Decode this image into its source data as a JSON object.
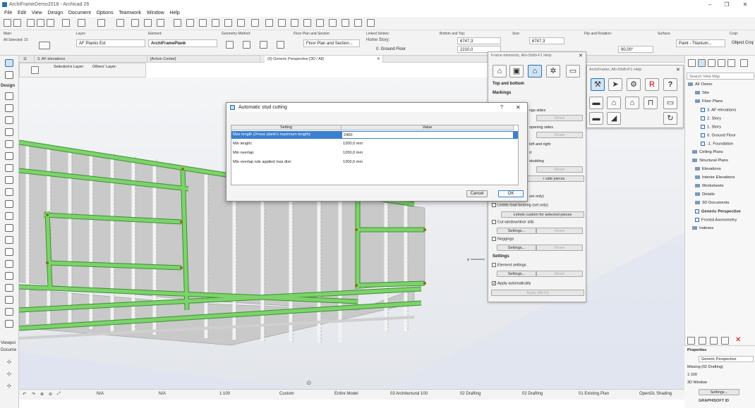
{
  "app": {
    "title": "ArchiFrameDemo2018 - Archicad 26"
  },
  "menu": [
    "File",
    "Edit",
    "View",
    "Design",
    "Document",
    "Options",
    "Teamwork",
    "Window",
    "Help"
  ],
  "infobox": {
    "main_label": "Main:",
    "all_selected": "All Selected: 15",
    "layer_label": "Layer:",
    "layer_value": "AF Planks Ext",
    "element_label": "Element:",
    "element_value": "ArchiFramePlank",
    "geometry_label": "Geometry Method:",
    "floorplan_label": "Floor Plan and Section:",
    "floorplan_value": "Floor Plan and Section...",
    "linked_label": "Linked Stories:",
    "home_story_label": "Home Story:",
    "home_story_value": "0. Ground Floor",
    "bottom_top_label": "Bottom and Top:",
    "top_value": "6747,3",
    "bottom_value": "2210,0",
    "size_label": "Size:",
    "size_value": "6747,3",
    "flip_label": "Flip and Rotation:",
    "rotation_value": "90,00°",
    "surface_label": "Surface:",
    "surface_value": "Paint - Titanium...",
    "crop_label": "Crop:",
    "crop_value": "Object Crop"
  },
  "toolbox": {
    "design": "Design",
    "viewpoint": "Viewpoi",
    "document": "Docume"
  },
  "tabs": [
    "3. AF elevations",
    "[Action Center]",
    "(0) Generic Perspective [3D / All]"
  ],
  "layerbar": {
    "selection_layer": "Selection's Layer:",
    "others_layer": "Others' Layer:"
  },
  "dialog": {
    "title": "Automatic stud cutting",
    "help": "?",
    "col_setting": "Setting",
    "col_value": "Value",
    "rows": [
      {
        "setting": "Max length (0=use plank's maximum length):",
        "value": "2400"
      },
      {
        "setting": "Min length:",
        "value": "1200,0 mm"
      },
      {
        "setting": "Min overlap:",
        "value": "1200,0 mm"
      },
      {
        "setting": "Min overlap rule applied max dist:",
        "value": "1200,0 mm"
      }
    ],
    "cancel": "Cancel",
    "ok": "OK"
  },
  "frame_palette": {
    "title": "Frame elements, Alt+Shift+F1 Help",
    "top_bottom": "Top and bottom",
    "markings": "Markings",
    "partial_1": "ngs sides",
    "reset": "Reset",
    "partial_2": "opening sides",
    "partial_3": "left and right",
    "partial_4": "rt",
    "partial_5": "studding",
    "side_pieces": "r side pieces",
    "partial_6": "set only)",
    "lintels_load": "Lintels load bearing (set only)",
    "lintels_custom": "Lintels custom for selected pieces",
    "cut_window": "Cut window/door sills",
    "settings_btn": "Settings...",
    "noggings": "Noggings",
    "settings_head": "Settings",
    "element_settings": "Element settings",
    "apply_auto": "Apply automatically",
    "apply_btn": "Apply (Alt+0)"
  },
  "frame_palette2": {
    "title": "ArchiFrame, Alt+Shift+F1 Help"
  },
  "navigator": {
    "search_placeholder": "Search View Map",
    "items": [
      {
        "label": "AF Demo",
        "level": 0
      },
      {
        "label": "Site",
        "level": 1
      },
      {
        "label": "Floor Plans",
        "level": 1
      },
      {
        "label": "3. AF elevations",
        "level": 2
      },
      {
        "label": "2. Story",
        "level": 2
      },
      {
        "label": "1. Story",
        "level": 2
      },
      {
        "label": "0. Ground Floor",
        "level": 2
      },
      {
        "label": "-1. Foundation",
        "level": 2
      },
      {
        "label": "Ceiling Plans",
        "level": 1
      },
      {
        "label": "Structural Plans",
        "level": 1
      },
      {
        "label": "Elevations",
        "level": 1
      },
      {
        "label": "Interior Elevations",
        "level": 1
      },
      {
        "label": "Worksheets",
        "level": 1
      },
      {
        "label": "Details",
        "level": 1
      },
      {
        "label": "3D Documents",
        "level": 1
      },
      {
        "label": "Generic Perspective",
        "level": 1
      },
      {
        "label": "Frontal Axonometry",
        "level": 1
      },
      {
        "label": "Indexes",
        "level": 1
      }
    ]
  },
  "properties": {
    "title": "Properties",
    "name": "Generic Perspective",
    "layer": "Missing (02 Drafting)",
    "scale": "1:100",
    "window": "3D Window",
    "settings": "Settings...",
    "brand": "GRAPHISOFT ID"
  },
  "statusbar": {
    "na1": "N/A",
    "na2": "N/A",
    "scale": "1:100",
    "custom": "Custom",
    "entire": "Entire Model",
    "arch": "03 Architectural 100",
    "drafting1": "02 Drafting",
    "drafting2": "02 Drafting",
    "existing": "01 Existing Plan",
    "shading": "OpenGL Shading"
  },
  "colors": {
    "accent": "#3b7fd1",
    "stud_green": "#7cd36a",
    "stud_dark": "#3f8f34"
  }
}
